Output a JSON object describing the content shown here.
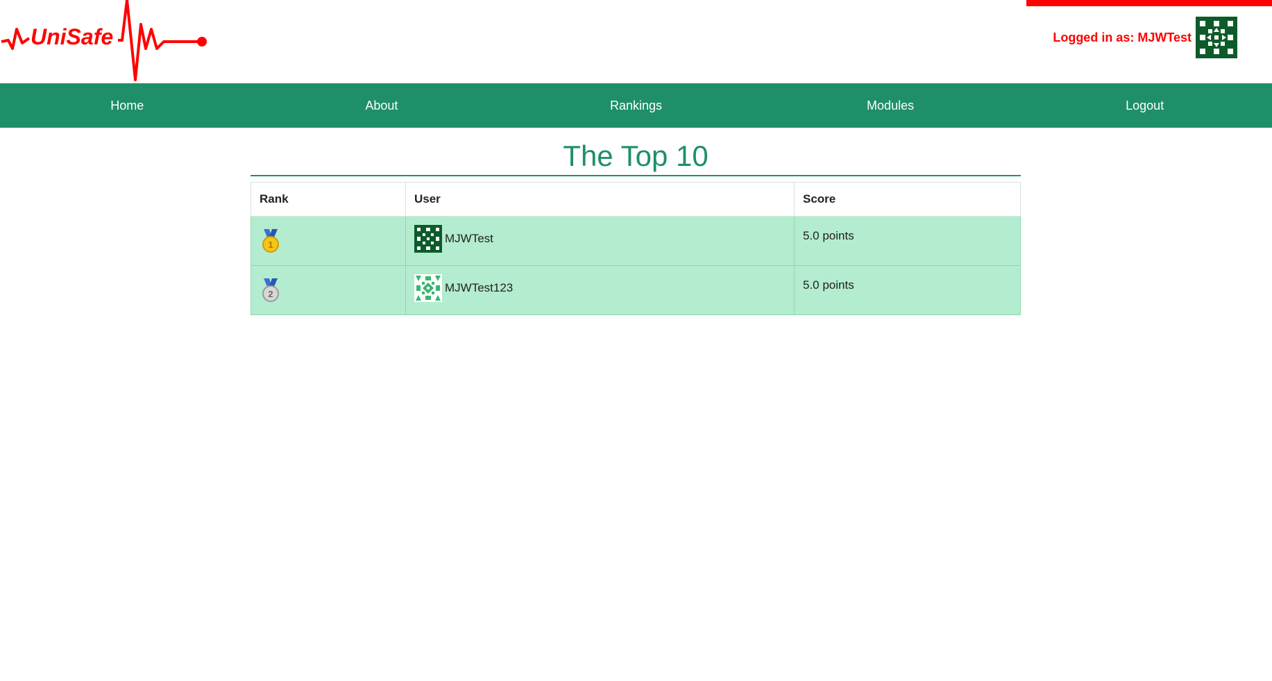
{
  "brand": {
    "logo_text": "UniSafe",
    "color": "#ff0000"
  },
  "account": {
    "logged_in_text": "Logged in as: MJWTest"
  },
  "nav": {
    "items": [
      {
        "label": "Home"
      },
      {
        "label": "About"
      },
      {
        "label": "Rankings"
      },
      {
        "label": "Modules"
      },
      {
        "label": "Logout"
      }
    ]
  },
  "page": {
    "title": "The Top 10"
  },
  "table": {
    "headers": [
      "Rank",
      "User",
      "Score"
    ],
    "rows": [
      {
        "rank": "1",
        "medal": "gold-medal-icon",
        "user": "MJWTest",
        "score": "5.0 points"
      },
      {
        "rank": "2",
        "medal": "silver-medal-icon",
        "user": "MJWTest123",
        "score": "5.0 points"
      }
    ]
  },
  "colors": {
    "accent": "#1e8f69",
    "row_bg": "#b3ecce",
    "alert": "#ff0000"
  }
}
